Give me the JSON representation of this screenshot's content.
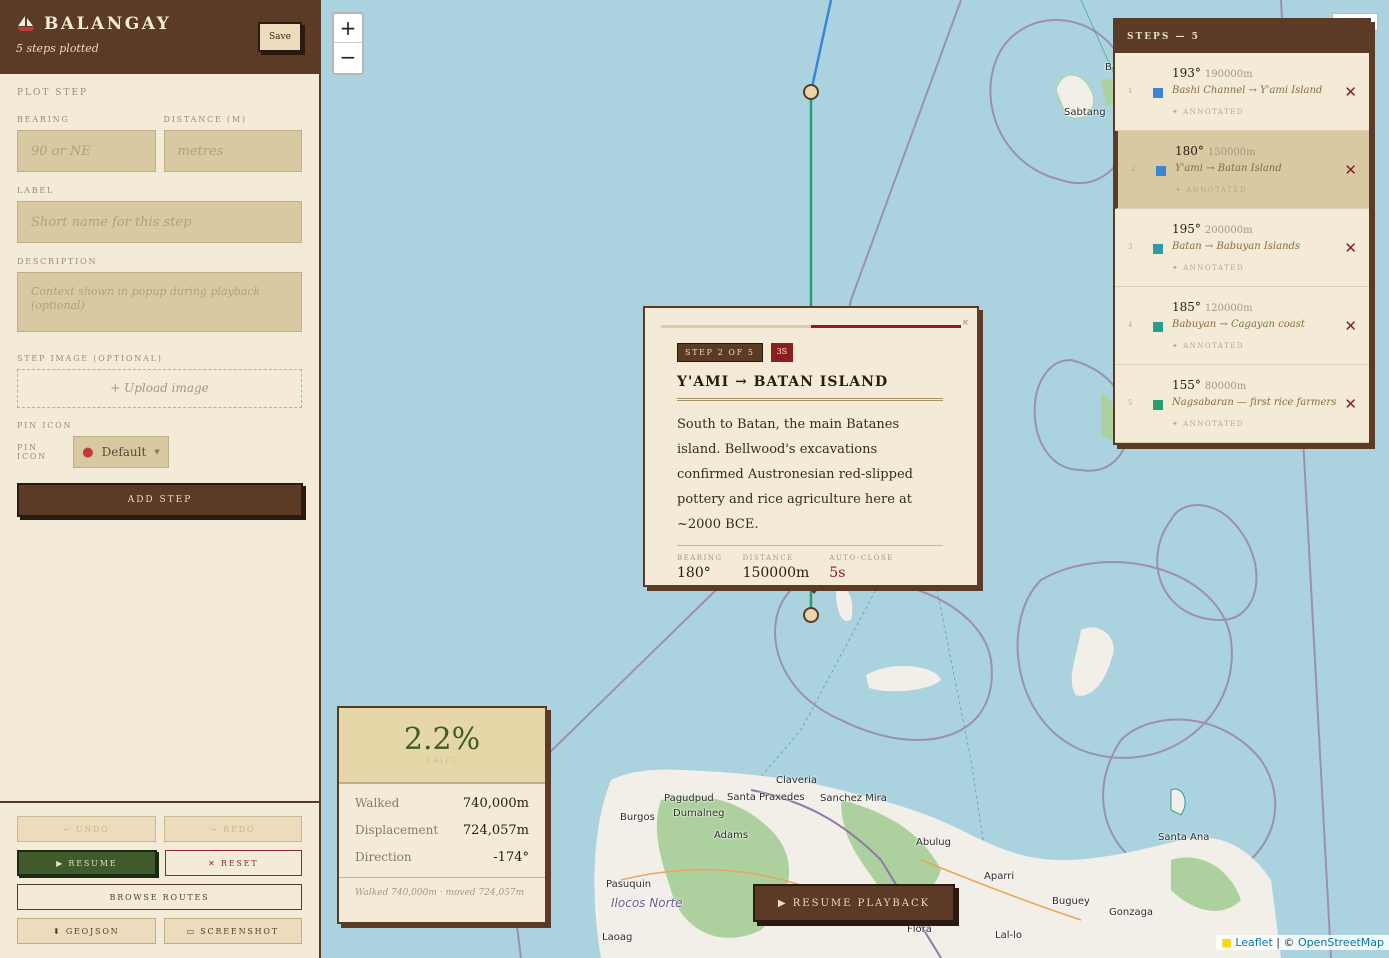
{
  "app": {
    "title": "BALANGAY",
    "subtitle": "5 steps plotted",
    "save_label": "Save"
  },
  "plot": {
    "section_title": "PLOT STEP",
    "bearing_label": "BEARING",
    "bearing_placeholder": "90 or NE",
    "distance_label": "DISTANCE (M)",
    "distance_placeholder": "metres",
    "label_label": "LABEL",
    "label_placeholder": "Short name for this step",
    "description_label": "DESCRIPTION",
    "description_placeholder": "Context shown in popup during playback (optional)",
    "image_label": "STEP IMAGE (OPTIONAL)",
    "upload_label": "+ Upload image",
    "pin_section_label": "PIN ICON",
    "pin_label": "PIN ICON",
    "pin_value": "Default",
    "add_step_label": "ADD STEP"
  },
  "footer": {
    "undo_label": "↩ UNDO",
    "redo_label": "↪ REDO",
    "resume_label": "▶ RESUME",
    "reset_label": "✕ RESET",
    "browse_label": "BROWSE ROUTES",
    "geojson_label": "⬇ GEOJSON",
    "screenshot_label": "▭ SCREENSHOT"
  },
  "map": {
    "zoom_in": "+",
    "zoom_out": "−",
    "attribution_leaflet": "Leaflet",
    "attribution_sep": " | © ",
    "attribution_osm": "OpenStreetMap",
    "places": {
      "sabtang": "Sabtang",
      "ba": "Ba",
      "claveria": "Claveria",
      "pagudpud": "Pagudpud",
      "santa_praxedes": "Santa Praxedes",
      "sanchez_mira": "Sanchez Mira",
      "dumalneg": "Dumalneg",
      "burgos": "Burgos",
      "adams": "Adams",
      "abulug": "Abulug",
      "santa_ana": "Santa Ana",
      "aparri": "Aparri",
      "pasuquin": "Pasuquin",
      "ilocos_norte": "Ilocos Norte",
      "buguey": "Buguey",
      "gonzaga": "Gonzaga",
      "laoag": "Laoag",
      "flora": "Flora",
      "lal_lo": "Lal-lo"
    },
    "colors": {
      "sea": "#aad3df",
      "land": "#f2efe9",
      "forest": "#add19e",
      "route_done": "#2a9d6f",
      "route_first": "#3a86d4",
      "boundary": "#9b8fb5"
    }
  },
  "popup": {
    "progress_fraction": 0.5,
    "close": "×",
    "step_badge": "STEP 2 OF 5",
    "time_badge": "3S",
    "title": "Y'AMI → BATAN ISLAND",
    "body": "South to Batan, the main Batanes island. Bellwood's excavations confirmed Austronesian red-slipped pottery and rice agriculture here at ~2000 BCE.",
    "stats": {
      "bearing_label": "BEARING",
      "bearing_value": "180°",
      "distance_label": "DISTANCE",
      "distance_value": "150000m",
      "auto_label": "AUTO-CLOSE",
      "auto_value": "5s"
    }
  },
  "steps_panel": {
    "title": "STEPS — 5",
    "annotated_label": "✦ ANNOTATED",
    "steps": [
      {
        "num": "1",
        "bearing": "193°",
        "distance": "190000m",
        "route": "Bashi Channel → Y'ami Island",
        "color": "#3a86d4",
        "active": false
      },
      {
        "num": "2",
        "bearing": "180°",
        "distance": "150000m",
        "route": "Y'ami → Batan Island",
        "color": "#3a86d4",
        "active": true
      },
      {
        "num": "3",
        "bearing": "195°",
        "distance": "200000m",
        "route": "Batan → Babuyan Islands",
        "color": "#2a9da0",
        "active": false
      },
      {
        "num": "4",
        "bearing": "185°",
        "distance": "120000m",
        "route": "Babuyan → Cagayan coast",
        "color": "#2a9d8a",
        "active": false
      },
      {
        "num": "5",
        "bearing": "155°",
        "distance": "80000m",
        "route": "Nagsabaran — first rice farmers",
        "color": "#2a9d6f",
        "active": false
      }
    ]
  },
  "stats": {
    "drift_value": "2.2%",
    "drift_label": "DRIFT",
    "walked_label": "Walked",
    "walked_value": "740,000m",
    "displacement_label": "Displacement",
    "displacement_value": "724,057m",
    "direction_label": "Direction",
    "direction_value": "-174°",
    "footnote": "Walked 740,000m · moved 724,057m"
  },
  "resume_playback_label": "▶ RESUME PLAYBACK"
}
